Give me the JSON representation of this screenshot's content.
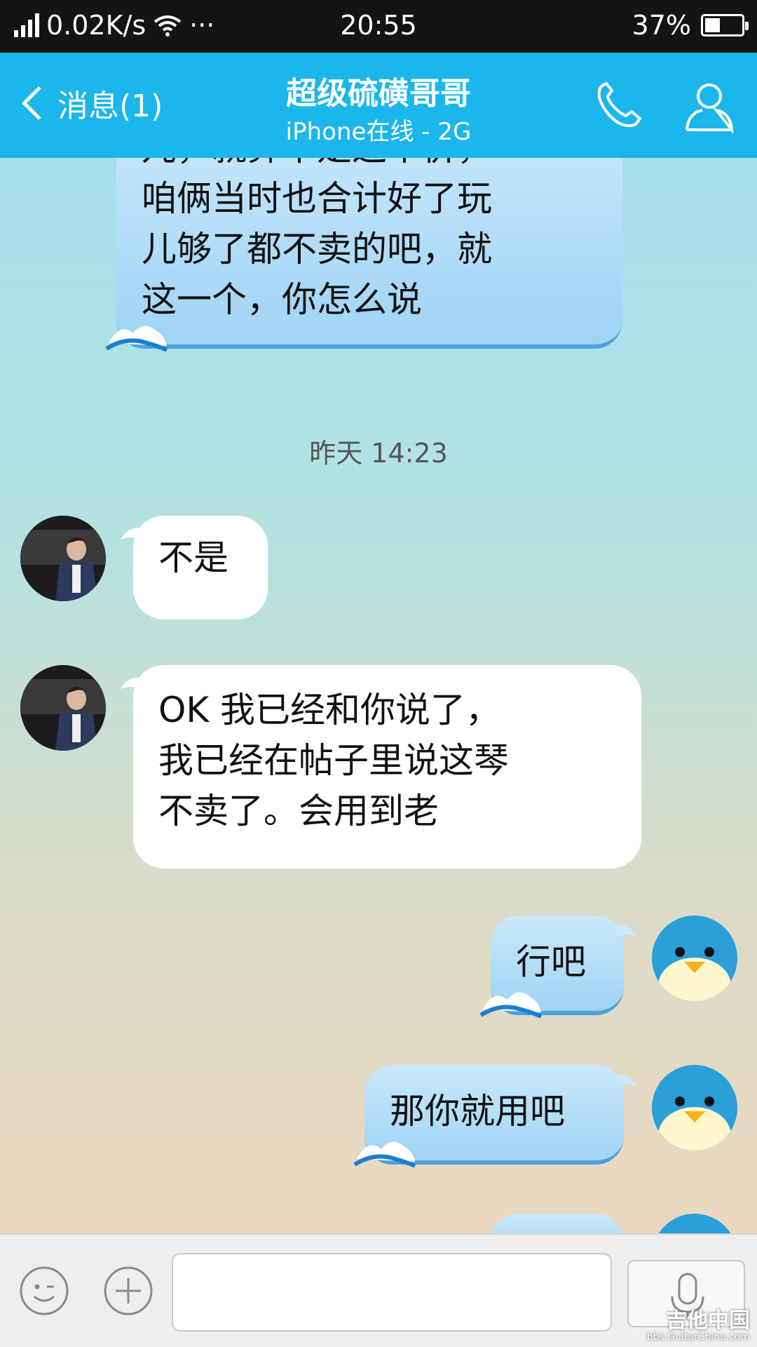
{
  "status": {
    "net_speed": "0.02K/s",
    "dots": "···",
    "time": "20:55",
    "battery_percent": "37%",
    "battery_level": 0.37
  },
  "header": {
    "back_label": "消息(1)",
    "title": "超级硫磺哥哥",
    "subtitle": "iPhone在线 - 2G"
  },
  "messages": [
    {
      "side": "out",
      "text": "儿，就算不是这个价，"
    },
    {
      "side": "out",
      "text": "咱俩当时也合计好了玩"
    },
    {
      "side": "out",
      "text": "儿够了都不卖的吧，就"
    },
    {
      "side": "out",
      "text": "这一个，你怎么说"
    }
  ],
  "timestamp": "昨天 14:23",
  "incoming": [
    {
      "lines": [
        "不是"
      ]
    },
    {
      "lines": [
        "OK 我已经和你说了，",
        "我已经在帖子里说这琴",
        "不卖了。会用到老"
      ]
    }
  ],
  "outgoing": [
    {
      "text": "行吧"
    },
    {
      "text": "那你就用吧"
    }
  ],
  "watermark": {
    "text": "吉他中国",
    "url": "bbs.GuitarChina.com"
  },
  "colors": {
    "titlebar": "#1ab6ec",
    "statusbar": "#141414"
  }
}
